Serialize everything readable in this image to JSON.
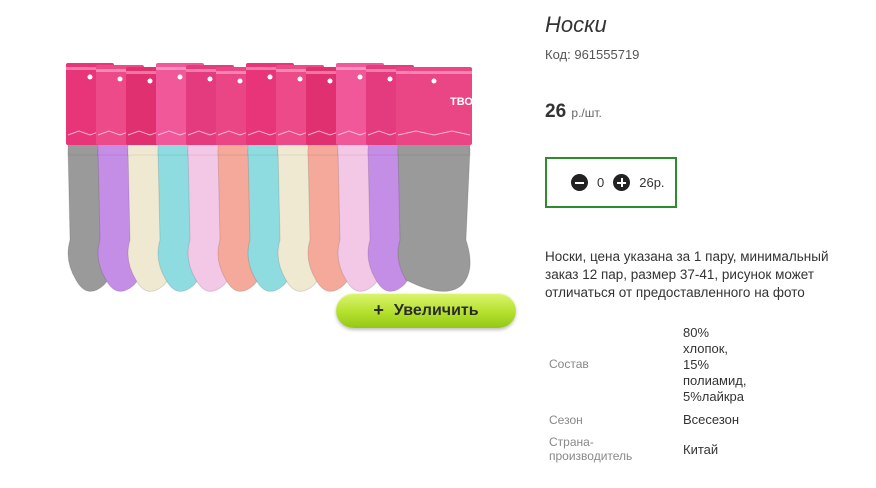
{
  "product": {
    "title": "Носки",
    "code_label": "Код:",
    "code": "961555719",
    "price": "26",
    "price_unit": "р./шт.",
    "quantity": "0",
    "total": "26р.",
    "description": "Носки, цена указана за 1 пару, минимальный заказ 12 пар, размер 37-41, рисунок может отличаться от предоставленного на фото",
    "zoom_label": "Увеличить",
    "package_text": "ТВОЙ СТИЛЬ"
  },
  "properties": {
    "composition_label": "Состав",
    "composition_lines": [
      "80%",
      "хлопок,",
      "15%",
      "полиамид,",
      "5%лайкра"
    ],
    "season_label": "Сезон",
    "season_value": "Всесезон",
    "country_label_lines": [
      "Страна-",
      "производитель"
    ],
    "country_value": "Китай"
  },
  "colors": {
    "qty_border": "#2e8b2e",
    "zoom_button": "#b5e02e",
    "sock_colors": [
      "#9a9a9a",
      "#c48de6",
      "#efe9d2",
      "#8fdce0",
      "#f3c8e6",
      "#f4a99a",
      "#8fdce0",
      "#efe9d2",
      "#f4a99a",
      "#f3c8e6",
      "#c48de6",
      "#9a9a9a"
    ]
  }
}
